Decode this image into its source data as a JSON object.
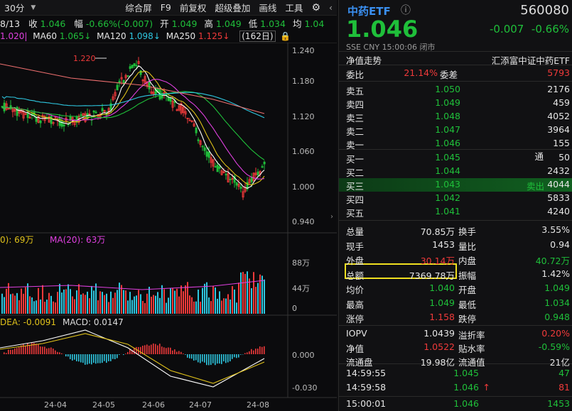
{
  "toolbar": {
    "period": "30分",
    "items": [
      "综合屏",
      "F9",
      "前复权",
      "超级叠加",
      "画线",
      "工具"
    ],
    "gear_icon": "gear-icon"
  },
  "info_line": {
    "date": "8/13",
    "close_label": "收",
    "close": "1.046",
    "change_label": "幅",
    "change": "-0.66%(-0.007)",
    "open_label": "开",
    "open": "1.049",
    "high_label": "高",
    "high": "1.049",
    "low_label": "低",
    "low": "1.034",
    "avg_label": "均",
    "avg": "1.04"
  },
  "ma_line": {
    "ma_a": "1.020",
    "ma60": "MA60",
    "ma60_val": "1.065",
    "ma120": "MA120",
    "ma120_val": "1.098",
    "ma250": "MA250",
    "ma250_val": "1.125",
    "count": "(162日)"
  },
  "price_axis": [
    "1.240",
    "1.180",
    "1.120",
    "1.060",
    "1.000",
    "0.940"
  ],
  "peak_label": "1.220",
  "volume": {
    "header_a": "0): 69万",
    "header_ma": "MA(20): 63万",
    "axis": [
      "88万",
      "44万",
      "0"
    ]
  },
  "macd": {
    "header_dea": "DEA: -0.0091",
    "header_macd": "MACD: 0.0147",
    "axis": [
      "0.000",
      "-0.030"
    ]
  },
  "date_axis": [
    "24-04",
    "24-05",
    "24-06",
    "24-07",
    "24-08"
  ],
  "quote": {
    "name": "中药ETF",
    "code": "560080",
    "price": "1.046",
    "change": "-0.007",
    "change_pct": "-0.66%",
    "exchange": "SSE",
    "currency": "CNY",
    "time": "15:00:06",
    "status": "闭市",
    "nav_label": "净值走势",
    "fund_name": "汇添富中证中药ETF",
    "weibi_label": "委比",
    "weibi": "21.14%",
    "weicha_label": "委差",
    "weicha": "5793",
    "asks": [
      {
        "label": "卖五",
        "price": "1.050",
        "vol": "2176"
      },
      {
        "label": "卖四",
        "price": "1.049",
        "vol": "459"
      },
      {
        "label": "卖三",
        "price": "1.048",
        "vol": "4052"
      },
      {
        "label": "卖二",
        "price": "1.047",
        "vol": "3964"
      },
      {
        "label": "卖一",
        "price": "1.046",
        "vol": "155"
      }
    ],
    "tong": "通",
    "bids": [
      {
        "label": "买一",
        "price": "1.045",
        "vol": "50"
      },
      {
        "label": "买二",
        "price": "1.044",
        "vol": "2432"
      },
      {
        "label": "买三",
        "price": "1.043",
        "vol": "4044",
        "tag": "卖出"
      },
      {
        "label": "买四",
        "price": "1.042",
        "vol": "5833"
      },
      {
        "label": "买五",
        "price": "1.041",
        "vol": "4240"
      }
    ],
    "stats": [
      {
        "l1": "总量",
        "v1": "70.85万",
        "l2": "换手",
        "v2": "3.55%",
        "c1": "white",
        "c2": "white"
      },
      {
        "l1": "现手",
        "v1": "1453",
        "l2": "量比",
        "v2": "0.94",
        "c1": "white",
        "c2": "white"
      },
      {
        "l1": "外盘",
        "v1": "30.14万",
        "l2": "内盘",
        "v2": "40.72万",
        "c1": "red",
        "c2": "green"
      },
      {
        "l1": "总额",
        "v1": "7369.78万",
        "l2": "振幅",
        "v2": "1.42%",
        "c1": "white",
        "c2": "white"
      },
      {
        "l1": "均价",
        "v1": "1.040",
        "l2": "开盘",
        "v2": "1.049",
        "c1": "green",
        "c2": "green"
      },
      {
        "l1": "最高",
        "v1": "1.049",
        "l2": "最低",
        "v2": "1.034",
        "c1": "green",
        "c2": "green"
      },
      {
        "l1": "涨停",
        "v1": "1.158",
        "l2": "跌停",
        "v2": "0.948",
        "c1": "red",
        "c2": "green"
      }
    ],
    "extra": [
      {
        "l1": "IOPV",
        "v1": "1.0439",
        "l2": "溢折率",
        "v2": "0.20%",
        "c1": "white",
        "c2": "red"
      },
      {
        "l1": "净值",
        "v1": "1.0522",
        "l2": "贴水率",
        "v2": "-0.59%",
        "c1": "red",
        "c2": "green"
      },
      {
        "l1": "流通盘",
        "v1": "19.98亿",
        "l2": "流通值",
        "v2": "21亿",
        "c1": "white",
        "c2": "white"
      }
    ],
    "ticks": [
      {
        "time": "14:59:55",
        "price": "1.045",
        "vol": "47",
        "arrow": ""
      },
      {
        "time": "14:59:58",
        "price": "1.046",
        "vol": "81",
        "arrow": "↑"
      },
      {
        "time": "15:00:01",
        "price": "1.046",
        "vol": "1453",
        "arrow": ""
      }
    ]
  },
  "colors": {
    "up": "#f03a3a",
    "down": "#1fbf3a",
    "ma5": "#ffffff",
    "ma10": "#e0c21a",
    "ma20": "#e040e0",
    "ma60": "#1fbf3a",
    "ma120": "#2ec7e0",
    "ma250": "#f07070",
    "highlight": "#f0e020"
  }
}
